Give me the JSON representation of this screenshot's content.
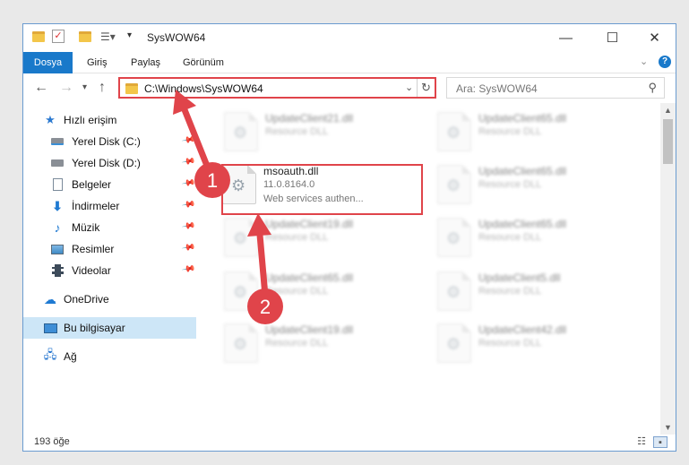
{
  "window": {
    "title": "SysWOW64",
    "minimize": "—",
    "maximize": "☐",
    "close": "✕"
  },
  "ribbon": {
    "tabs": [
      "Dosya",
      "Giriş",
      "Paylaş",
      "Görünüm"
    ],
    "help": "?"
  },
  "nav": {
    "address": "C:\\Windows\\SysWOW64",
    "search_placeholder": "Ara: SysWOW64"
  },
  "sidebar": {
    "items": [
      {
        "label": "Hızlı erişim",
        "icon": "star-icon",
        "pinned": false
      },
      {
        "label": "Yerel Disk (C:)",
        "icon": "drive-icon",
        "pinned": true
      },
      {
        "label": "Yerel Disk (D:)",
        "icon": "drive-icon",
        "pinned": true
      },
      {
        "label": "Belgeler",
        "icon": "documents-icon",
        "pinned": true
      },
      {
        "label": "İndirmeler",
        "icon": "download-icon",
        "pinned": true
      },
      {
        "label": "Müzik",
        "icon": "music-icon",
        "pinned": true
      },
      {
        "label": "Resimler",
        "icon": "pictures-icon",
        "pinned": true
      },
      {
        "label": "Videolar",
        "icon": "video-icon",
        "pinned": true
      },
      {
        "label": "OneDrive",
        "icon": "cloud-icon",
        "pinned": false
      },
      {
        "label": "Bu bilgisayar",
        "icon": "computer-icon",
        "pinned": false,
        "selected": true
      },
      {
        "label": "Ağ",
        "icon": "network-icon",
        "pinned": false
      }
    ]
  },
  "files": {
    "highlighted": {
      "name": "msoauth.dll",
      "version": "11.0.8164.0",
      "description": "Web services authen..."
    },
    "left_column": [
      {
        "name": "UpdateClient21.dll",
        "type": "Resource DLL"
      },
      {
        "name": "UpdateClient19.dll",
        "type": "Resource DLL"
      },
      {
        "name": "UpdateClient65.dll",
        "type": "Resource DLL"
      },
      {
        "name": "UpdateClient19.dll",
        "type": "Resource DLL"
      }
    ],
    "right_column": [
      {
        "name": "UpdateClient65.dll",
        "type": "Resource DLL"
      },
      {
        "name": "UpdateClient65.dll",
        "type": "Resource DLL"
      },
      {
        "name": "UpdateClient65.dll",
        "type": "Resource DLL"
      },
      {
        "name": "UpdateClient5.dll",
        "type": "Resource DLL"
      },
      {
        "name": "UpdateClient42.dll",
        "type": "Resource DLL"
      }
    ]
  },
  "status": {
    "count": "193 öğe"
  },
  "annotations": {
    "badge1": "1",
    "badge2": "2",
    "color": "#e0444a"
  }
}
